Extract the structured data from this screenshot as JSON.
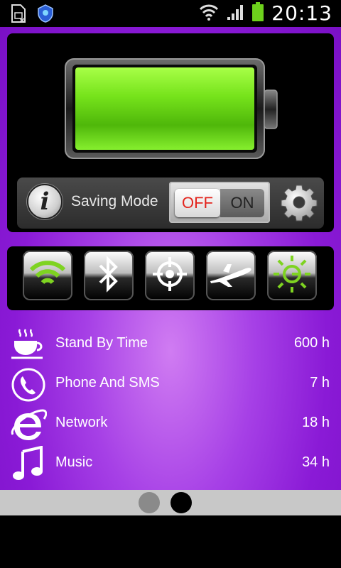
{
  "status_bar": {
    "time": "20:13",
    "icons": [
      "sim-card-icon",
      "app-shield-icon",
      "wifi-icon",
      "signal-icon",
      "battery-charging-icon"
    ],
    "battery_color": "#6dd11c"
  },
  "battery": {
    "level_fraction": 1.0,
    "fill_color": "#6ee21a"
  },
  "saving_mode": {
    "label": "Saving Mode",
    "toggle_off": "OFF",
    "toggle_on": "ON",
    "state": "OFF",
    "off_color": "#e3241d"
  },
  "quick_toggles": [
    {
      "name": "wifi",
      "icon": "wifi-icon",
      "active": true
    },
    {
      "name": "bluetooth",
      "icon": "bluetooth-icon",
      "active": false
    },
    {
      "name": "gps",
      "icon": "gps-target-icon",
      "active": false
    },
    {
      "name": "airplane",
      "icon": "airplane-icon",
      "active": false
    },
    {
      "name": "brightness",
      "icon": "brightness-icon",
      "active": true
    }
  ],
  "usage_list": [
    {
      "label": "Stand By Time",
      "value": "600 h",
      "icon": "coffee-cup-icon"
    },
    {
      "label": "Phone And SMS",
      "value": "7 h",
      "icon": "phone-icon"
    },
    {
      "label": "Network",
      "value": "18 h",
      "icon": "internet-explorer-icon"
    },
    {
      "label": "Music",
      "value": "34 h",
      "icon": "music-note-icon"
    }
  ],
  "pager": {
    "page_count": 2,
    "current_page": 2
  },
  "colors": {
    "background_purple": "#9a2de0",
    "accent_green": "#7ed321"
  }
}
